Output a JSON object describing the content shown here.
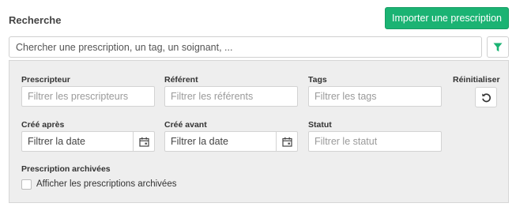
{
  "header": {
    "title": "Recherche",
    "import_button": "Importer une prescription"
  },
  "search": {
    "placeholder": "Chercher une prescription, un tag, un soignant, ...",
    "filter_icon": "funnel-icon"
  },
  "filters": {
    "prescripteur": {
      "label": "Prescripteur",
      "placeholder": "Filtrer les prescripteurs"
    },
    "referent": {
      "label": "Référent",
      "placeholder": "Filtrer les référents"
    },
    "tags": {
      "label": "Tags",
      "placeholder": "Filtrer les tags"
    },
    "reset": {
      "label": "Réinitialiser",
      "icon": "undo-icon"
    },
    "cree_apres": {
      "label": "Créé après",
      "placeholder": "Filtrer la date",
      "icon": "calendar-icon"
    },
    "cree_avant": {
      "label": "Créé avant",
      "placeholder": "Filtrer la date",
      "icon": "calendar-icon"
    },
    "statut": {
      "label": "Statut",
      "placeholder": "Filtrer le statut"
    },
    "archived": {
      "label": "Prescription archivées",
      "checkbox_label": "Afficher les prescriptions archivées",
      "checked": false
    }
  },
  "colors": {
    "accent": "#1bb373",
    "panel_bg": "#eeeeee"
  }
}
